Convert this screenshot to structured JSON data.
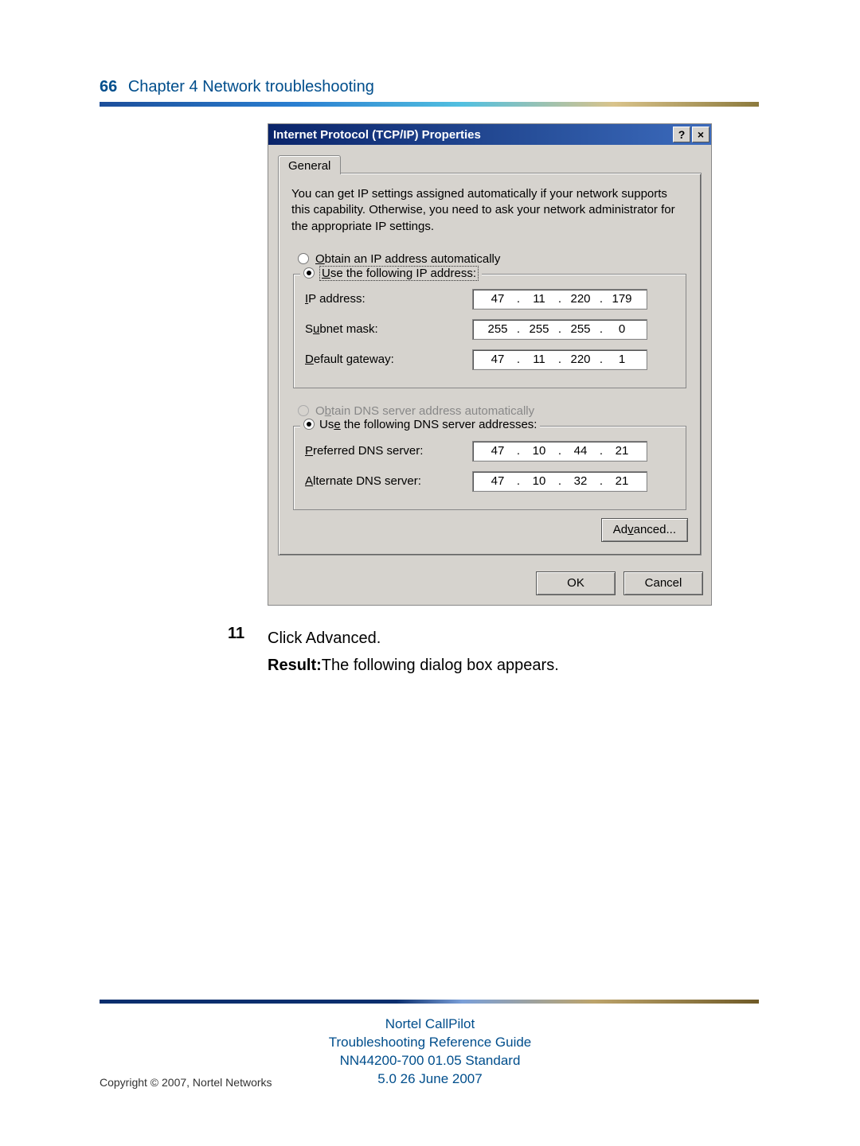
{
  "header": {
    "page_number": "66",
    "chapter": "Chapter 4  Network troubleshooting"
  },
  "dialog": {
    "title": "Internet Protocol (TCP/IP) Properties",
    "help_btn": "?",
    "close_btn": "×",
    "tab_general": "General",
    "intro": "You can get IP settings assigned automatically if your network supports this capability. Otherwise, you need to ask your network administrator for the appropriate IP settings.",
    "radio_obtain_ip_pre": "O",
    "radio_obtain_ip_rest": "btain an IP address automatically",
    "radio_use_ip_pre": "U",
    "radio_use_ip_rest": "se the following IP address:",
    "label_ip_pre": "I",
    "label_ip_rest": "P address:",
    "label_subnet_pre": "S",
    "label_subnet_mid": "u",
    "label_subnet_rest": "bnet mask:",
    "label_gw_pre": "D",
    "label_gw_rest": "efault gateway:",
    "ip_address": [
      "47",
      "11",
      "220",
      "179"
    ],
    "subnet_mask": [
      "255",
      "255",
      "255",
      "0"
    ],
    "gateway": [
      "47",
      "11",
      "220",
      "1"
    ],
    "radio_obtain_dns_pre": "O",
    "radio_obtain_dns_mid": "b",
    "radio_obtain_dns_rest": "tain DNS server address automatically",
    "radio_use_dns_pre": "Us",
    "radio_use_dns_mid": "e",
    "radio_use_dns_rest": " the following DNS server addresses:",
    "label_pref_dns_pre": "P",
    "label_pref_dns_rest": "referred DNS server:",
    "label_alt_dns_pre": "A",
    "label_alt_dns_rest": "lternate DNS server:",
    "pref_dns": [
      "47",
      "10",
      "44",
      "21"
    ],
    "alt_dns": [
      "47",
      "10",
      "32",
      "21"
    ],
    "btn_advanced_pre": "Ad",
    "btn_advanced_mid": "v",
    "btn_advanced_rest": "anced...",
    "btn_ok": "OK",
    "btn_cancel": "Cancel"
  },
  "step": {
    "number": "11",
    "line1": "Click Advanced.",
    "result_label": "Result:",
    "result_text": "The following dialog box appears."
  },
  "footer": {
    "line1": "Nortel CallPilot",
    "line2": "Troubleshooting Reference Guide",
    "line3": "NN44200-700   01.05   Standard",
    "line4": "5.0   26 June 2007",
    "copyright": "Copyright © 2007, Nortel Networks"
  },
  "dot": "."
}
